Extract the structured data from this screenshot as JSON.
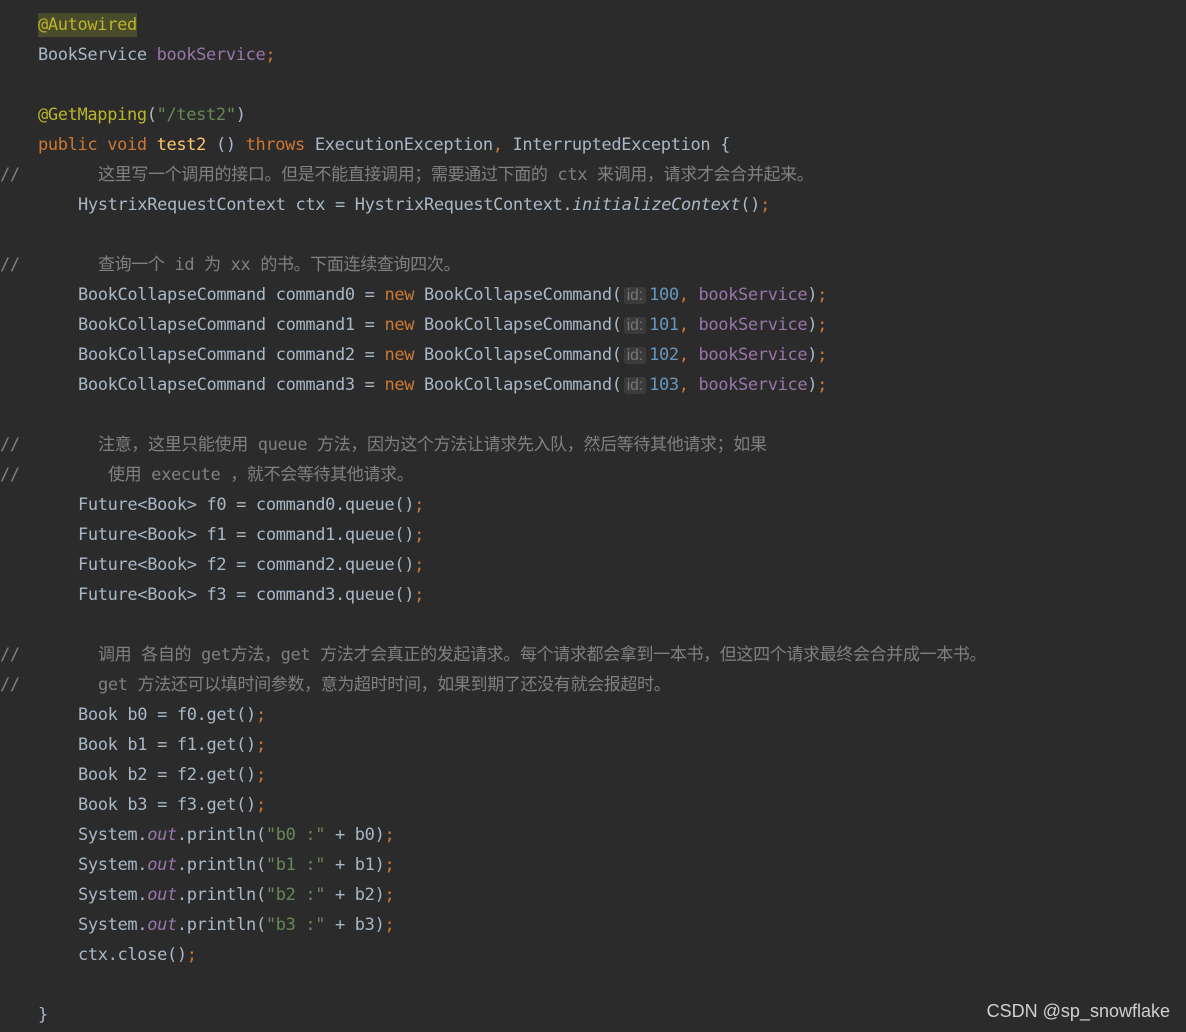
{
  "editor": {
    "lines": [
      {
        "indent": 38,
        "tokens": [
          {
            "t": "@Autowired",
            "c": "ann-hl"
          }
        ]
      },
      {
        "indent": 38,
        "tokens": [
          {
            "t": "BookService ",
            "c": "plain"
          },
          {
            "t": "bookService",
            "c": "field"
          },
          {
            "t": ";",
            "c": "kw"
          }
        ]
      },
      {
        "indent": 38,
        "tokens": []
      },
      {
        "indent": 38,
        "tokens": [
          {
            "t": "@GetMapping",
            "c": "ann"
          },
          {
            "t": "(",
            "c": "plain"
          },
          {
            "t": "\"/test2\"",
            "c": "str"
          },
          {
            "t": ")",
            "c": "plain"
          }
        ]
      },
      {
        "indent": 38,
        "tokens": [
          {
            "t": "public ",
            "c": "kw"
          },
          {
            "t": "void ",
            "c": "kw"
          },
          {
            "t": "test2 ",
            "c": "fn"
          },
          {
            "t": "() ",
            "c": "plain"
          },
          {
            "t": "throws ",
            "c": "kw"
          },
          {
            "t": "ExecutionException",
            "c": "plain"
          },
          {
            "t": ", ",
            "c": "kw"
          },
          {
            "t": "InterruptedException {",
            "c": "plain"
          }
        ]
      },
      {
        "indent": 98,
        "comment": true,
        "tokens": [
          {
            "t": "这里写一个调用的接口。但是不能直接调用；需要通过下面的 ctx 来调用，请求才会合并起来。",
            "c": "cmt"
          }
        ]
      },
      {
        "indent": 78,
        "tokens": [
          {
            "t": "HystrixRequestContext ctx = HystrixRequestContext.",
            "c": "plain"
          },
          {
            "t": "initializeContext",
            "c": "italic"
          },
          {
            "t": "()",
            "c": "plain"
          },
          {
            "t": ";",
            "c": "kw"
          }
        ]
      },
      {
        "indent": 78,
        "tokens": []
      },
      {
        "indent": 98,
        "comment": true,
        "tokens": [
          {
            "t": "查询一个 id 为 xx 的书。下面连续查询四次。",
            "c": "cmt"
          }
        ]
      },
      {
        "indent": 78,
        "tokens": [
          {
            "t": "BookCollapseCommand command0 = ",
            "c": "plain"
          },
          {
            "t": "new ",
            "c": "kw"
          },
          {
            "t": "BookCollapseCommand(",
            "c": "plain"
          },
          {
            "t": "id:",
            "c": "hint"
          },
          {
            "t": "100",
            "c": "num"
          },
          {
            "t": ", ",
            "c": "kw"
          },
          {
            "t": "bookService",
            "c": "field"
          },
          {
            "t": ")",
            "c": "plain"
          },
          {
            "t": ";",
            "c": "kw"
          }
        ]
      },
      {
        "indent": 78,
        "tokens": [
          {
            "t": "BookCollapseCommand command1 = ",
            "c": "plain"
          },
          {
            "t": "new ",
            "c": "kw"
          },
          {
            "t": "BookCollapseCommand(",
            "c": "plain"
          },
          {
            "t": "id:",
            "c": "hint"
          },
          {
            "t": "101",
            "c": "num"
          },
          {
            "t": ", ",
            "c": "kw"
          },
          {
            "t": "bookService",
            "c": "field"
          },
          {
            "t": ")",
            "c": "plain"
          },
          {
            "t": ";",
            "c": "kw"
          }
        ]
      },
      {
        "indent": 78,
        "tokens": [
          {
            "t": "BookCollapseCommand command2 = ",
            "c": "plain"
          },
          {
            "t": "new ",
            "c": "kw"
          },
          {
            "t": "BookCollapseCommand(",
            "c": "plain"
          },
          {
            "t": "id:",
            "c": "hint"
          },
          {
            "t": "102",
            "c": "num"
          },
          {
            "t": ", ",
            "c": "kw"
          },
          {
            "t": "bookService",
            "c": "field"
          },
          {
            "t": ")",
            "c": "plain"
          },
          {
            "t": ";",
            "c": "kw"
          }
        ]
      },
      {
        "indent": 78,
        "tokens": [
          {
            "t": "BookCollapseCommand command3 = ",
            "c": "plain"
          },
          {
            "t": "new ",
            "c": "kw"
          },
          {
            "t": "BookCollapseCommand(",
            "c": "plain"
          },
          {
            "t": "id:",
            "c": "hint"
          },
          {
            "t": "103",
            "c": "num"
          },
          {
            "t": ", ",
            "c": "kw"
          },
          {
            "t": "bookService",
            "c": "field"
          },
          {
            "t": ")",
            "c": "plain"
          },
          {
            "t": ";",
            "c": "kw"
          }
        ]
      },
      {
        "indent": 78,
        "tokens": []
      },
      {
        "indent": 98,
        "comment": true,
        "tokens": [
          {
            "t": "注意，这里只能使用 queue 方法，因为这个方法让请求先入队，然后等待其他请求；如果",
            "c": "cmt"
          }
        ]
      },
      {
        "indent": 108,
        "comment": true,
        "tokens": [
          {
            "t": "使用 execute ，就不会等待其他请求。",
            "c": "cmt"
          }
        ]
      },
      {
        "indent": 78,
        "tokens": [
          {
            "t": "Future<Book> f0 = command0.queue()",
            "c": "plain"
          },
          {
            "t": ";",
            "c": "kw"
          }
        ]
      },
      {
        "indent": 78,
        "tokens": [
          {
            "t": "Future<Book> f1 = command1.queue()",
            "c": "plain"
          },
          {
            "t": ";",
            "c": "kw"
          }
        ]
      },
      {
        "indent": 78,
        "tokens": [
          {
            "t": "Future<Book> f2 = command2.queue()",
            "c": "plain"
          },
          {
            "t": ";",
            "c": "kw"
          }
        ]
      },
      {
        "indent": 78,
        "tokens": [
          {
            "t": "Future<Book> f3 = command3.queue()",
            "c": "plain"
          },
          {
            "t": ";",
            "c": "kw"
          }
        ]
      },
      {
        "indent": 78,
        "tokens": []
      },
      {
        "indent": 98,
        "comment": true,
        "tokens": [
          {
            "t": "调用 各自的 get方法，get 方法才会真正的发起请求。每个请求都会拿到一本书，但这四个请求最终会合并成一本书。",
            "c": "cmt"
          }
        ]
      },
      {
        "indent": 98,
        "comment": true,
        "tokens": [
          {
            "t": "get 方法还可以填时间参数，意为超时时间，如果到期了还没有就会报超时。",
            "c": "cmt"
          }
        ]
      },
      {
        "indent": 78,
        "tokens": [
          {
            "t": "Book b0 = f0.get()",
            "c": "plain"
          },
          {
            "t": ";",
            "c": "kw"
          }
        ]
      },
      {
        "indent": 78,
        "tokens": [
          {
            "t": "Book b1 = f1.get()",
            "c": "plain"
          },
          {
            "t": ";",
            "c": "kw"
          }
        ]
      },
      {
        "indent": 78,
        "tokens": [
          {
            "t": "Book b2 = f2.get()",
            "c": "plain"
          },
          {
            "t": ";",
            "c": "kw"
          }
        ]
      },
      {
        "indent": 78,
        "tokens": [
          {
            "t": "Book b3 = f3.get()",
            "c": "plain"
          },
          {
            "t": ";",
            "c": "kw"
          }
        ]
      },
      {
        "indent": 78,
        "tokens": [
          {
            "t": "System.",
            "c": "plain"
          },
          {
            "t": "out",
            "c": "static"
          },
          {
            "t": ".println(",
            "c": "plain"
          },
          {
            "t": "\"b0 :\"",
            "c": "str"
          },
          {
            "t": " + b0)",
            "c": "plain"
          },
          {
            "t": ";",
            "c": "kw"
          }
        ]
      },
      {
        "indent": 78,
        "tokens": [
          {
            "t": "System.",
            "c": "plain"
          },
          {
            "t": "out",
            "c": "static"
          },
          {
            "t": ".println(",
            "c": "plain"
          },
          {
            "t": "\"b1 :\"",
            "c": "str"
          },
          {
            "t": " + b1)",
            "c": "plain"
          },
          {
            "t": ";",
            "c": "kw"
          }
        ]
      },
      {
        "indent": 78,
        "tokens": [
          {
            "t": "System.",
            "c": "plain"
          },
          {
            "t": "out",
            "c": "static"
          },
          {
            "t": ".println(",
            "c": "plain"
          },
          {
            "t": "\"b2 :\"",
            "c": "str"
          },
          {
            "t": " + b2)",
            "c": "plain"
          },
          {
            "t": ";",
            "c": "kw"
          }
        ]
      },
      {
        "indent": 78,
        "tokens": [
          {
            "t": "System.",
            "c": "plain"
          },
          {
            "t": "out",
            "c": "static"
          },
          {
            "t": ".println(",
            "c": "plain"
          },
          {
            "t": "\"b3 :\"",
            "c": "str"
          },
          {
            "t": " + b3)",
            "c": "plain"
          },
          {
            "t": ";",
            "c": "kw"
          }
        ]
      },
      {
        "indent": 78,
        "tokens": [
          {
            "t": "ctx.close()",
            "c": "plain"
          },
          {
            "t": ";",
            "c": "kw"
          }
        ]
      },
      {
        "indent": 78,
        "tokens": []
      },
      {
        "indent": 38,
        "tokens": [
          {
            "t": "}",
            "c": "plain"
          }
        ]
      }
    ],
    "comment_marker": "//"
  },
  "watermark": "CSDN @sp_snowflake",
  "colors": {
    "background": "#2b2b2b",
    "plain": "#a9b7c6",
    "keyword": "#cc7832",
    "annotation": "#bbb529",
    "method": "#ffc66d",
    "field": "#9876aa",
    "string": "#6a8759",
    "number": "#6897bb",
    "comment": "#808080"
  }
}
